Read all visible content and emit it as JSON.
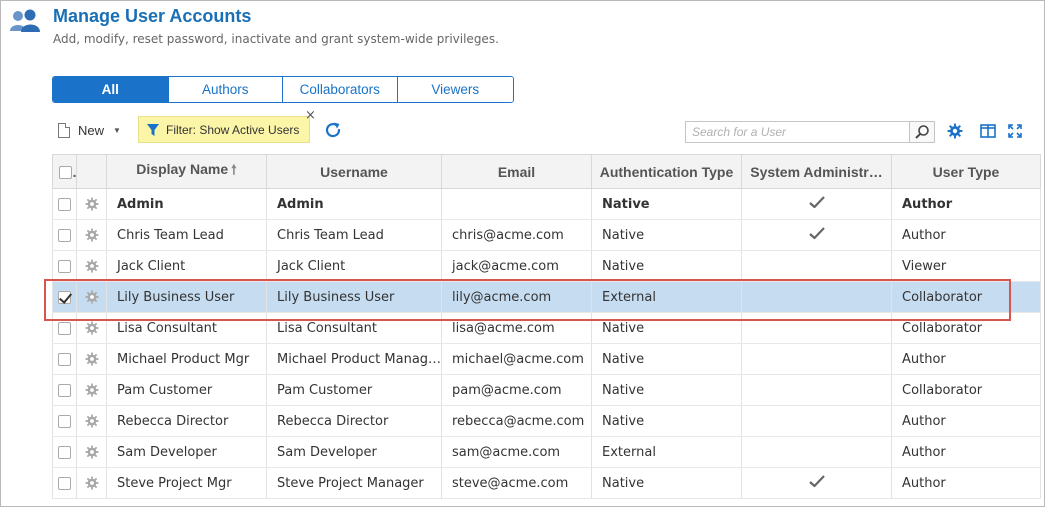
{
  "header": {
    "title": "Manage User Accounts",
    "subtitle": "Add, modify, reset password, inactivate and grant system-wide privileges.",
    "icon": "users-icon"
  },
  "tabs": [
    {
      "label": "All",
      "active": true
    },
    {
      "label": "Authors",
      "active": false
    },
    {
      "label": "Collaborators",
      "active": false
    },
    {
      "label": "Viewers",
      "active": false
    }
  ],
  "toolbar": {
    "new_label": "New",
    "filter_label": "Filter: Show Active Users",
    "filter_close": "×",
    "search_placeholder": "Search for a User"
  },
  "colors": {
    "accent": "#1a73c8",
    "filter_bg": "#fbf5a8",
    "selected_row": "#c6ddf1",
    "highlight_box": "#d9534f"
  },
  "table": {
    "columns": [
      "Display Name",
      "Username",
      "Email",
      "Authentication Type",
      "System Administr…",
      "User Type"
    ],
    "sort_column": "Display Name",
    "rows": [
      {
        "display_name": "Admin",
        "username": "Admin",
        "email": "",
        "auth": "Native",
        "sysadmin": true,
        "user_type": "Author",
        "bold": true,
        "checked": false
      },
      {
        "display_name": "Chris Team Lead",
        "username": "Chris Team Lead",
        "email": "chris@acme.com",
        "auth": "Native",
        "sysadmin": true,
        "user_type": "Author",
        "bold": false,
        "checked": false
      },
      {
        "display_name": "Jack Client",
        "username": "Jack Client",
        "email": "jack@acme.com",
        "auth": "Native",
        "sysadmin": false,
        "user_type": "Viewer",
        "bold": false,
        "checked": false
      },
      {
        "display_name": "Lily Business User",
        "username": "Lily Business User",
        "email": "lily@acme.com",
        "auth": "External",
        "sysadmin": false,
        "user_type": "Collaborator",
        "bold": false,
        "checked": true,
        "selected": true
      },
      {
        "display_name": "Lisa Consultant",
        "username": "Lisa Consultant",
        "email": "lisa@acme.com",
        "auth": "Native",
        "sysadmin": false,
        "user_type": "Collaborator",
        "bold": false,
        "checked": false
      },
      {
        "display_name": "Michael Product Mgr",
        "username": "Michael Product Manag…",
        "email": "michael@acme.com",
        "auth": "Native",
        "sysadmin": false,
        "user_type": "Author",
        "bold": false,
        "checked": false
      },
      {
        "display_name": "Pam Customer",
        "username": "Pam Customer",
        "email": "pam@acme.com",
        "auth": "Native",
        "sysadmin": false,
        "user_type": "Collaborator",
        "bold": false,
        "checked": false
      },
      {
        "display_name": "Rebecca Director",
        "username": "Rebecca Director",
        "email": "rebecca@acme.com",
        "auth": "Native",
        "sysadmin": false,
        "user_type": "Author",
        "bold": false,
        "checked": false
      },
      {
        "display_name": "Sam Developer",
        "username": "Sam Developer",
        "email": "sam@acme.com",
        "auth": "External",
        "sysadmin": false,
        "user_type": "Author",
        "bold": false,
        "checked": false
      },
      {
        "display_name": "Steve Project Mgr",
        "username": "Steve Project Manager",
        "email": "steve@acme.com",
        "auth": "Native",
        "sysadmin": true,
        "user_type": "Author",
        "bold": false,
        "checked": false
      }
    ]
  }
}
